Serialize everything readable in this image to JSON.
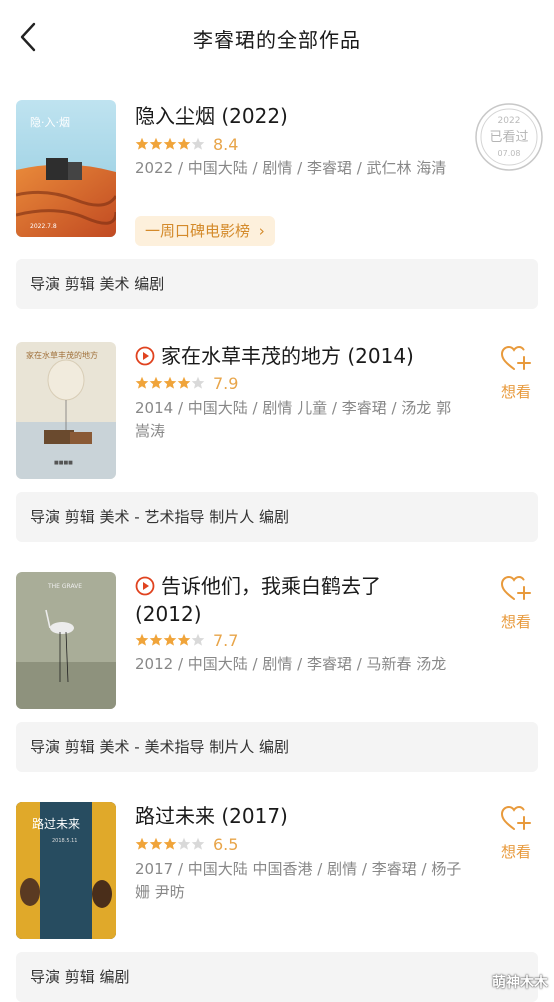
{
  "header": {
    "title": "李睿珺的全部作品"
  },
  "movies": [
    {
      "title": "隐入尘烟 (2022)",
      "stars": 4,
      "score": "8.4",
      "meta": "2022 / 中国大陆 / 剧情 / 李睿珺 / 武仁林 海清",
      "tag": "一周口碑电影榜",
      "tag_arrow": "›",
      "roles": "导演 剪辑 美术 编剧",
      "has_play": false,
      "seen_stamp": {
        "year": "2022",
        "label": "已看过",
        "date": "07.08"
      }
    },
    {
      "title": "家在水草丰茂的地方 (2014)",
      "stars": 4,
      "score": "7.9",
      "meta": "2014 / 中国大陆 / 剧情 儿童 / 李睿珺 / 汤龙 郭嵩涛",
      "want_label": "想看",
      "roles": "导演 剪辑 美术 - 艺术指导 制片人 编剧",
      "has_play": true
    },
    {
      "title": "告诉他们，我乘白鹤去了 (2012)",
      "stars": 4,
      "score": "7.7",
      "meta": "2012 / 中国大陆 / 剧情 / 李睿珺 / 马新春 汤龙",
      "want_label": "想看",
      "roles": "导演 剪辑 美术 - 美术指导 制片人 编剧",
      "has_play": true
    },
    {
      "title": "路过未来 (2017)",
      "stars": 3,
      "score": "6.5",
      "meta": "2017 / 中国大陆 中国香港 / 剧情 / 李睿珺 / 杨子姗 尹昉",
      "want_label": "想看",
      "roles": "导演 剪辑 编剧",
      "has_play": false
    }
  ],
  "watermark": "萌神木木",
  "colors": {
    "accent": "#e89a3c",
    "star": "#f0a43a",
    "star_empty": "#d9d9d9",
    "roles_bg": "#f4f4f4",
    "tag_bg": "#fdf0dc"
  }
}
